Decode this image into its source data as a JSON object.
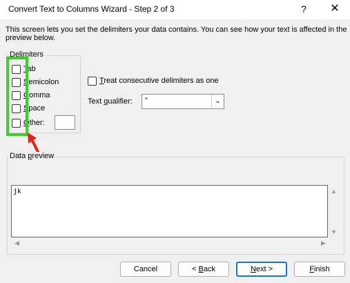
{
  "window": {
    "title": "Convert Text to Columns Wizard - Step 2 of 3",
    "help_label": "?",
    "close_label": "✕"
  },
  "description": "This screen lets you set the delimiters your data contains.  You can see how your text is affected in the preview below.",
  "delimiters": {
    "label": "Delimiters",
    "options": [
      {
        "pre": "",
        "key": "T",
        "post": "ab",
        "checked": false
      },
      {
        "pre": "",
        "key": "S",
        "post": "emicolon",
        "checked": false
      },
      {
        "pre": "",
        "key": "C",
        "post": "omma",
        "checked": false
      },
      {
        "pre": "",
        "key": "S",
        "post": "pace",
        "checked": false
      },
      {
        "pre": "",
        "key": "O",
        "post": "ther:",
        "checked": false
      }
    ],
    "other_value": ""
  },
  "consecutive": {
    "pre": "",
    "key": "T",
    "post": "reat consecutive delimiters as one",
    "checked": false
  },
  "qualifier": {
    "pre": "Text ",
    "key": "q",
    "post": "ualifier:",
    "value": "\""
  },
  "preview": {
    "pre": "Data ",
    "key": "p",
    "post": "review",
    "text": "jk"
  },
  "buttons": {
    "cancel": {
      "pre": "Cancel",
      "key": "",
      "post": ""
    },
    "back": {
      "pre": "< ",
      "key": "B",
      "post": "ack"
    },
    "next": {
      "pre": "",
      "key": "N",
      "post": "ext >"
    },
    "finish": {
      "pre": "",
      "key": "F",
      "post": "inish"
    }
  },
  "colors": {
    "highlight": "#3ccf2a",
    "arrow": "#e8211d",
    "primary_border": "#1e72c8"
  }
}
